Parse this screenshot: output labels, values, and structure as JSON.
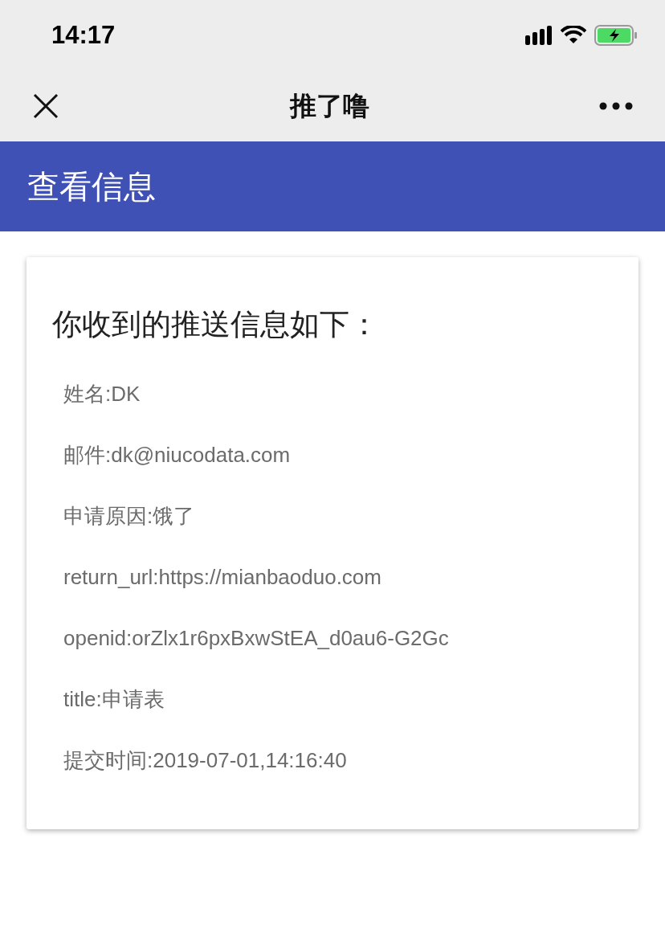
{
  "status_bar": {
    "time": "14:17"
  },
  "nav_bar": {
    "title": "推了噜"
  },
  "header": {
    "title": "查看信息"
  },
  "card": {
    "heading": "你收到的推送信息如下：",
    "lines": [
      "姓名:DK",
      "邮件:dk@niucodata.com",
      "申请原因:饿了",
      "return_url:https://mianbaoduo.com",
      "openid:orZlx1r6pxBxwStEA_d0au6-G2Gc",
      "title:申请表",
      "提交时间:2019-07-01,14:16:40"
    ]
  }
}
